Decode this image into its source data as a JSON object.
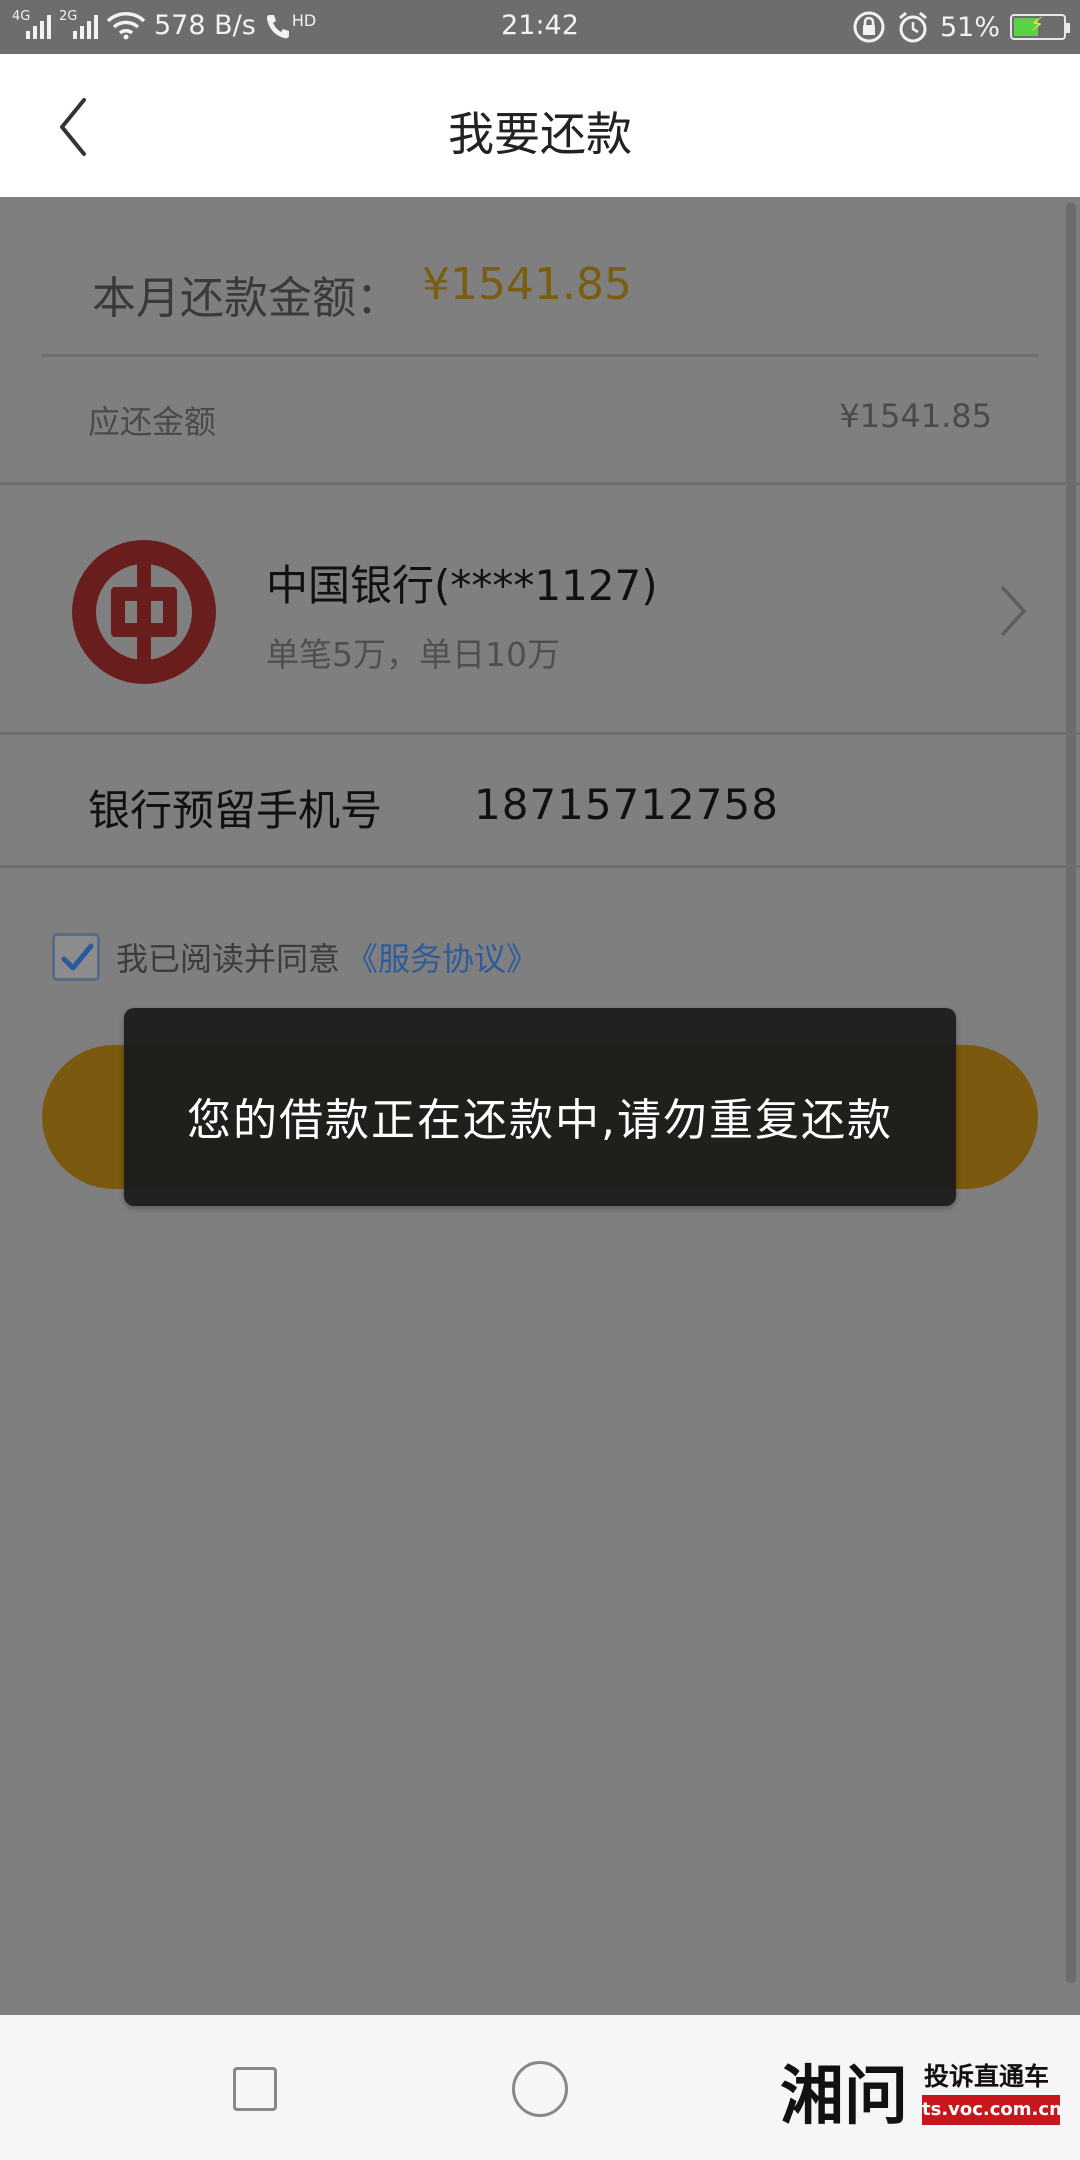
{
  "status_bar": {
    "net_left": "4G",
    "net_right": "2G",
    "speed": "578 B/s",
    "hd": "HD",
    "time": "21:42",
    "battery": "51%",
    "battery_level": 0.51
  },
  "header": {
    "title": "我要还款"
  },
  "repayment": {
    "month_label": "本月还款金额：",
    "month_amount": "¥1541.85",
    "due_label": "应还金额",
    "due_amount": "¥1541.85"
  },
  "bank": {
    "name": "中国银行(****1127)",
    "limit": "单笔5万，单日10万"
  },
  "phone": {
    "label": "银行预留手机号",
    "value": "18715712758"
  },
  "agreement": {
    "checked": true,
    "text": "我已阅读并同意",
    "link": "《服务协议》"
  },
  "toast": {
    "message": "您的借款正在还款中,请勿重复还款"
  },
  "watermark": {
    "brand": "湘问",
    "slogan": "投诉直通车",
    "url": "ts.voc.com.cn"
  },
  "colors": {
    "accent_amount": "#e3a300",
    "button": "#f5b400",
    "link": "#2f6fd0"
  }
}
